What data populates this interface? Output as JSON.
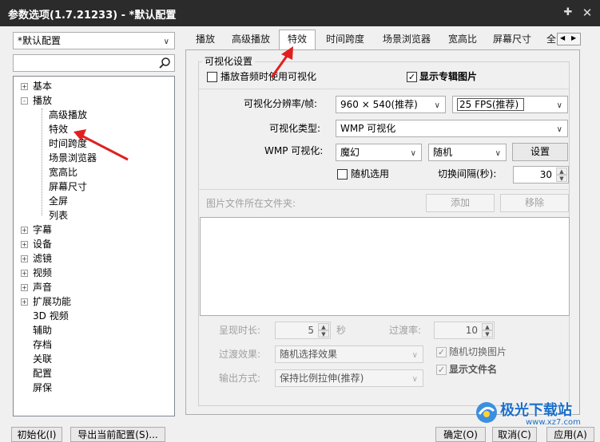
{
  "window": {
    "title": "参数选项(1.7.21233) - *默认配置",
    "pin_icon": "pin-icon",
    "close_icon": "close-icon"
  },
  "profile": {
    "value": "*默认配置"
  },
  "tree": {
    "items": [
      {
        "label": "基本",
        "expander": "+"
      },
      {
        "label": "播放",
        "expander": "-"
      },
      {
        "label": "高级播放"
      },
      {
        "label": "特效"
      },
      {
        "label": "时间跨度"
      },
      {
        "label": "场景浏览器"
      },
      {
        "label": "宽高比"
      },
      {
        "label": "屏幕尺寸"
      },
      {
        "label": "全屏"
      },
      {
        "label": "列表"
      },
      {
        "label": "字幕",
        "expander": "+"
      },
      {
        "label": "设备",
        "expander": "+"
      },
      {
        "label": "滤镜",
        "expander": "+"
      },
      {
        "label": "视频",
        "expander": "+"
      },
      {
        "label": "声音",
        "expander": "+"
      },
      {
        "label": "扩展功能",
        "expander": "+"
      },
      {
        "label": "3D 视频"
      },
      {
        "label": "辅助"
      },
      {
        "label": "存档"
      },
      {
        "label": "关联"
      },
      {
        "label": "配置"
      },
      {
        "label": "屏保"
      }
    ]
  },
  "tabs": [
    "播放",
    "高级播放",
    "特效",
    "时间跨度",
    "场景浏览器",
    "宽高比",
    "屏幕尺寸",
    "全"
  ],
  "active_tab": "特效",
  "vis": {
    "group_title": "可视化设置",
    "play_audio_use_vis": "播放音频时使用可视化",
    "show_album_art": "显示专辑图片",
    "resolution_label": "可视化分辨率/帧:",
    "resolution_value": "960 × 540(推荐)",
    "fps_value": "25 FPS(推荐)",
    "type_label": "可视化类型:",
    "type_value": "WMP 可视化",
    "wmp_label": "WMP 可视化:",
    "wmp_effect": "魔幻",
    "wmp_preset": "随机",
    "settings_button": "设置",
    "random_select": "随机选用",
    "switch_interval_label": "切换间隔(秒):",
    "switch_interval_value": "30"
  },
  "images": {
    "folder_label": "图片文件所在文件夹:",
    "add_button": "添加",
    "remove_button": "移除",
    "duration_label": "呈现时长:",
    "duration_value": "5",
    "duration_unit": "秒",
    "transition_rate_label": "过渡率:",
    "transition_rate_value": "10",
    "transition_effect_label": "过渡效果:",
    "transition_effect_value": "随机选择效果",
    "random_switch_image": "随机切换图片",
    "output_mode_label": "输出方式:",
    "output_mode_value": "保持比例拉伸(推荐)",
    "show_filename": "显示文件名"
  },
  "footer": {
    "init_button": "初始化(I)",
    "export_button": "导出当前配置(S)...",
    "ok_button": "确定(O)",
    "cancel_button": "取消(C)",
    "apply_button": "应用(A)"
  },
  "watermark": {
    "text": "极光下载站",
    "url": "www.xz7.com"
  },
  "colors": {
    "arrow": "#e02020",
    "titlebar": "#2b2b2b"
  }
}
